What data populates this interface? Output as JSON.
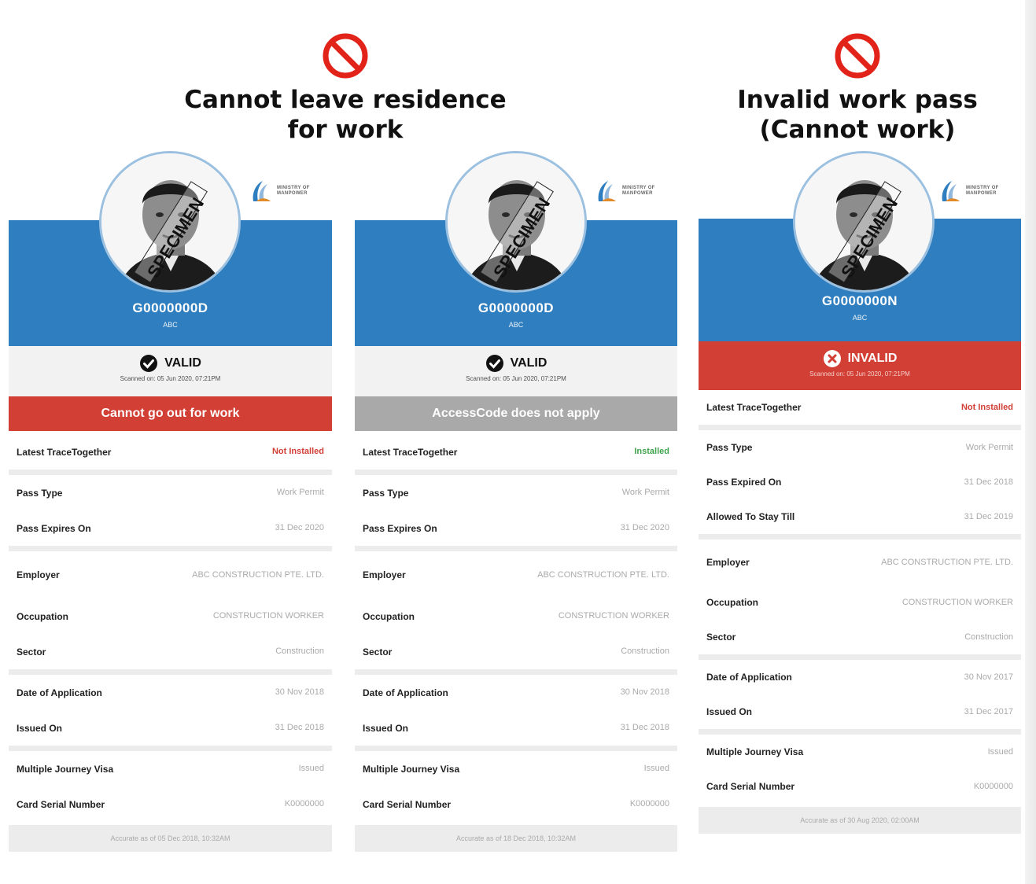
{
  "headings": {
    "left": {
      "line1": "Cannot leave residence",
      "line2": "for work"
    },
    "right": {
      "line1": "Invalid work pass",
      "line2": "(Cannot work)"
    }
  },
  "colors": {
    "blue": "#2f7fc0",
    "red": "#d23f34",
    "grey": "#a9a9a9",
    "green": "#3fa34d"
  },
  "logo_text": "MINISTRY OF MANPOWER",
  "photo_watermark": "SPECIMEN",
  "cards": [
    {
      "fin": "G0000000D",
      "company": "ABC",
      "status": "VALID",
      "status_icon": "check-circle-icon",
      "scanned": "Scanned on: 05 Jun 2020, 07:21PM",
      "banner": "Cannot go out for work",
      "tracetogether": {
        "label": "Latest TraceTogether",
        "value": "Not Installed"
      },
      "rows": [
        {
          "label": "Pass Type",
          "value": "Work Permit"
        },
        {
          "label": "Pass Expires On",
          "value": "31 Dec 2020"
        },
        {
          "label": "Employer",
          "value": "ABC CONSTRUCTION PTE. LTD."
        },
        {
          "label": "Occupation",
          "value": "CONSTRUCTION WORKER"
        },
        {
          "label": "Sector",
          "value": "Construction"
        },
        {
          "label": "Date of Application",
          "value": "30 Nov 2018"
        },
        {
          "label": "Issued On",
          "value": "31 Dec 2018"
        },
        {
          "label": "Multiple Journey Visa",
          "value": "Issued"
        },
        {
          "label": "Card Serial Number",
          "value": "K0000000"
        }
      ],
      "footer": "Accurate as of 05 Dec 2018, 10:32AM"
    },
    {
      "fin": "G0000000D",
      "company": "ABC",
      "status": "VALID",
      "status_icon": "check-circle-icon",
      "scanned": "Scanned on: 05 Jun 2020, 07:21PM",
      "banner": "AccessCode does not apply",
      "tracetogether": {
        "label": "Latest TraceTogether",
        "value": "Installed"
      },
      "rows": [
        {
          "label": "Pass Type",
          "value": "Work Permit"
        },
        {
          "label": "Pass Expires On",
          "value": "31 Dec 2020"
        },
        {
          "label": "Employer",
          "value": "ABC CONSTRUCTION PTE. LTD."
        },
        {
          "label": "Occupation",
          "value": "CONSTRUCTION WORKER"
        },
        {
          "label": "Sector",
          "value": "Construction"
        },
        {
          "label": "Date of Application",
          "value": "30 Nov 2018"
        },
        {
          "label": "Issued On",
          "value": "31 Dec 2018"
        },
        {
          "label": "Multiple Journey Visa",
          "value": "Issued"
        },
        {
          "label": "Card Serial Number",
          "value": "K0000000"
        }
      ],
      "footer": "Accurate as of 18 Dec 2018, 10:32AM"
    },
    {
      "fin": "G0000000N",
      "company": "ABC",
      "status": "INVALID",
      "status_icon": "x-circle-icon",
      "scanned": "Scanned on: 05 Jun 2020, 07:21PM",
      "tracetogether": {
        "label": "Latest TraceTogether",
        "value": "Not Installed"
      },
      "rows": [
        {
          "label": "Pass Type",
          "value": "Work Permit"
        },
        {
          "label": "Pass Expired On",
          "value": "31 Dec 2018"
        },
        {
          "label": "Allowed To Stay Till",
          "value": "31 Dec 2019"
        },
        {
          "label": "Employer",
          "value": "ABC CONSTRUCTION PTE. LTD."
        },
        {
          "label": "Occupation",
          "value": "CONSTRUCTION WORKER"
        },
        {
          "label": "Sector",
          "value": "Construction"
        },
        {
          "label": "Date of Application",
          "value": "30 Nov 2017"
        },
        {
          "label": "Issued On",
          "value": "31 Dec 2017"
        },
        {
          "label": "Multiple Journey Visa",
          "value": "Issued"
        },
        {
          "label": "Card Serial Number",
          "value": "K0000000"
        }
      ],
      "footer": "Accurate as of 30 Aug 2020, 02:00AM"
    }
  ]
}
